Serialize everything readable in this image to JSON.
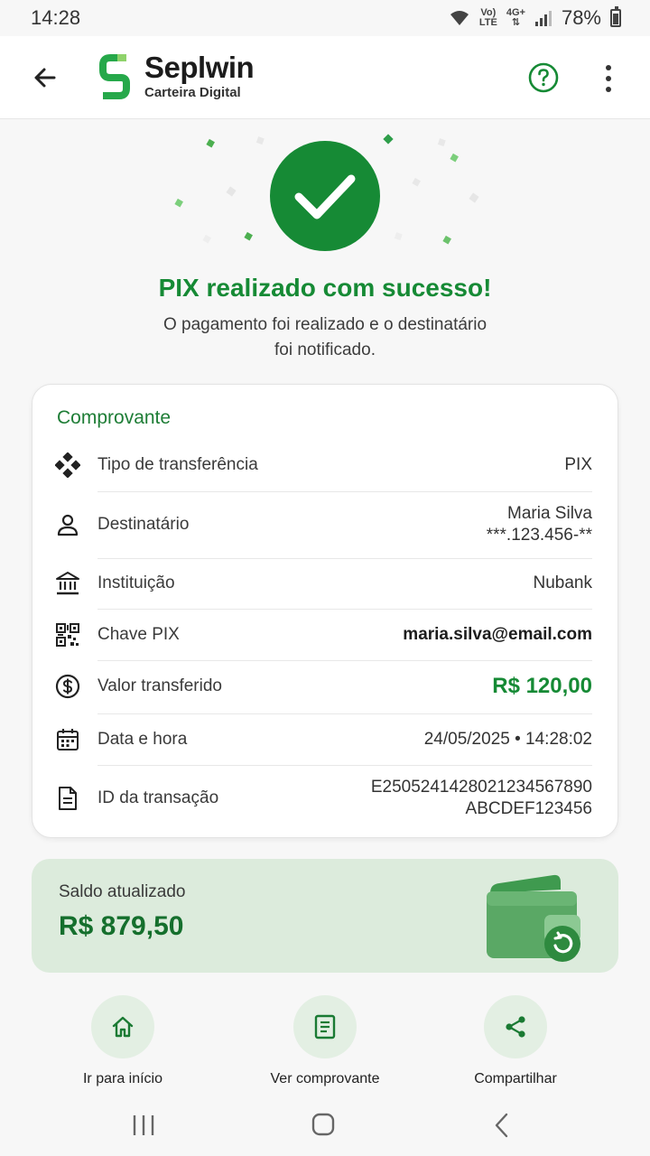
{
  "status_bar": {
    "time": "14:28",
    "volte_top": "Vo)",
    "volte_bottom": "LTE",
    "network_top": "4G+",
    "network_bottom": "⇅",
    "battery": "78%"
  },
  "app_bar": {
    "brand_name": "Seplwin",
    "brand_subtitle": "Carteira Digital"
  },
  "success": {
    "title": "PIX realizado com sucesso!",
    "message": "O pagamento foi realizado e o destinatário foi notificado."
  },
  "receipt": {
    "title": "Comprovante",
    "rows": [
      {
        "icon": "diamond-grid-icon",
        "label": "Tipo de transferência",
        "value": "PIX"
      },
      {
        "icon": "person-icon",
        "label": "Destinatário",
        "value": "Maria Silva",
        "value2": "***.123.456-**"
      },
      {
        "icon": "bank-icon",
        "label": "Instituição",
        "value": "Nubank"
      },
      {
        "icon": "qr-code-icon",
        "label": "Chave PIX",
        "value": "maria.silva@email.com"
      },
      {
        "icon": "dollar-circle-icon",
        "label": "Valor transferido",
        "value": "R$ 120,00"
      },
      {
        "icon": "calendar-icon",
        "label": "Data e hora",
        "value": "24/05/2025 • 14:28:02"
      },
      {
        "icon": "document-icon",
        "label": "ID da transação",
        "value": "E2505241428021234567890",
        "value2": "ABCDEF123456"
      }
    ]
  },
  "balance": {
    "label": "Saldo atualizado",
    "value": "R$ 879,50"
  },
  "actions": [
    {
      "label": "Ir para início",
      "icon": "home-icon"
    },
    {
      "label": "Ver comprovante",
      "icon": "receipt-icon"
    },
    {
      "label": "Compartilhar",
      "icon": "share-icon"
    }
  ],
  "colors": {
    "primary": "#168a35",
    "balance_bg": "#dcebdc",
    "action_bg": "#e3efe3"
  }
}
